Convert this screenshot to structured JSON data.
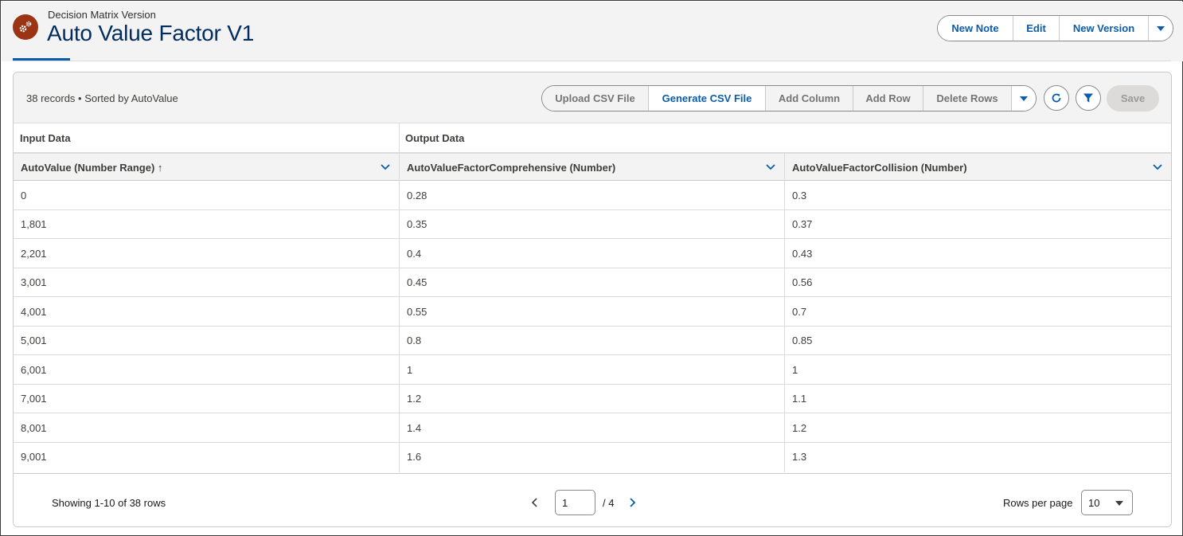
{
  "header": {
    "object_label": "Decision Matrix Version",
    "title": "Auto Value Factor V1",
    "actions": [
      "New Note",
      "Edit",
      "New Version"
    ]
  },
  "toolbar": {
    "record_info": "38 records • Sorted by AutoValue",
    "buttons": [
      "Upload CSV File",
      "Generate CSV File",
      "Add Column",
      "Add Row",
      "Delete Rows"
    ],
    "save_label": "Save"
  },
  "table": {
    "groups": [
      "Input Data",
      "Output Data"
    ],
    "columns": [
      "AutoValue (Number Range) ↑",
      "AutoValueFactorComprehensive (Number)",
      "AutoValueFactorCollision (Number)"
    ],
    "rows": [
      [
        "0",
        "0.28",
        "0.3"
      ],
      [
        "1,801",
        "0.35",
        "0.37"
      ],
      [
        "2,201",
        "0.4",
        "0.43"
      ],
      [
        "3,001",
        "0.45",
        "0.56"
      ],
      [
        "4,001",
        "0.55",
        "0.7"
      ],
      [
        "5,001",
        "0.8",
        "0.85"
      ],
      [
        "6,001",
        "1",
        "1"
      ],
      [
        "7,001",
        "1.2",
        "1.1"
      ],
      [
        "8,001",
        "1.4",
        "1.2"
      ],
      [
        "9,001",
        "1.6",
        "1.3"
      ]
    ]
  },
  "footer": {
    "showing": "Showing 1-10 of 38 rows",
    "current_page": "1",
    "total_pages": "/ 4",
    "rows_per_page_label": "Rows per page",
    "rows_per_page_value": "10"
  },
  "colors": {
    "brand_blue": "#0b5cab",
    "title_blue": "#032d60",
    "record_icon": "#9b3415"
  },
  "icons": [
    "decision-matrix-icon",
    "chevron-down-icon",
    "refresh-icon",
    "filter-icon",
    "chevron-left-icon",
    "chevron-right-icon",
    "sort-up-icon"
  ]
}
